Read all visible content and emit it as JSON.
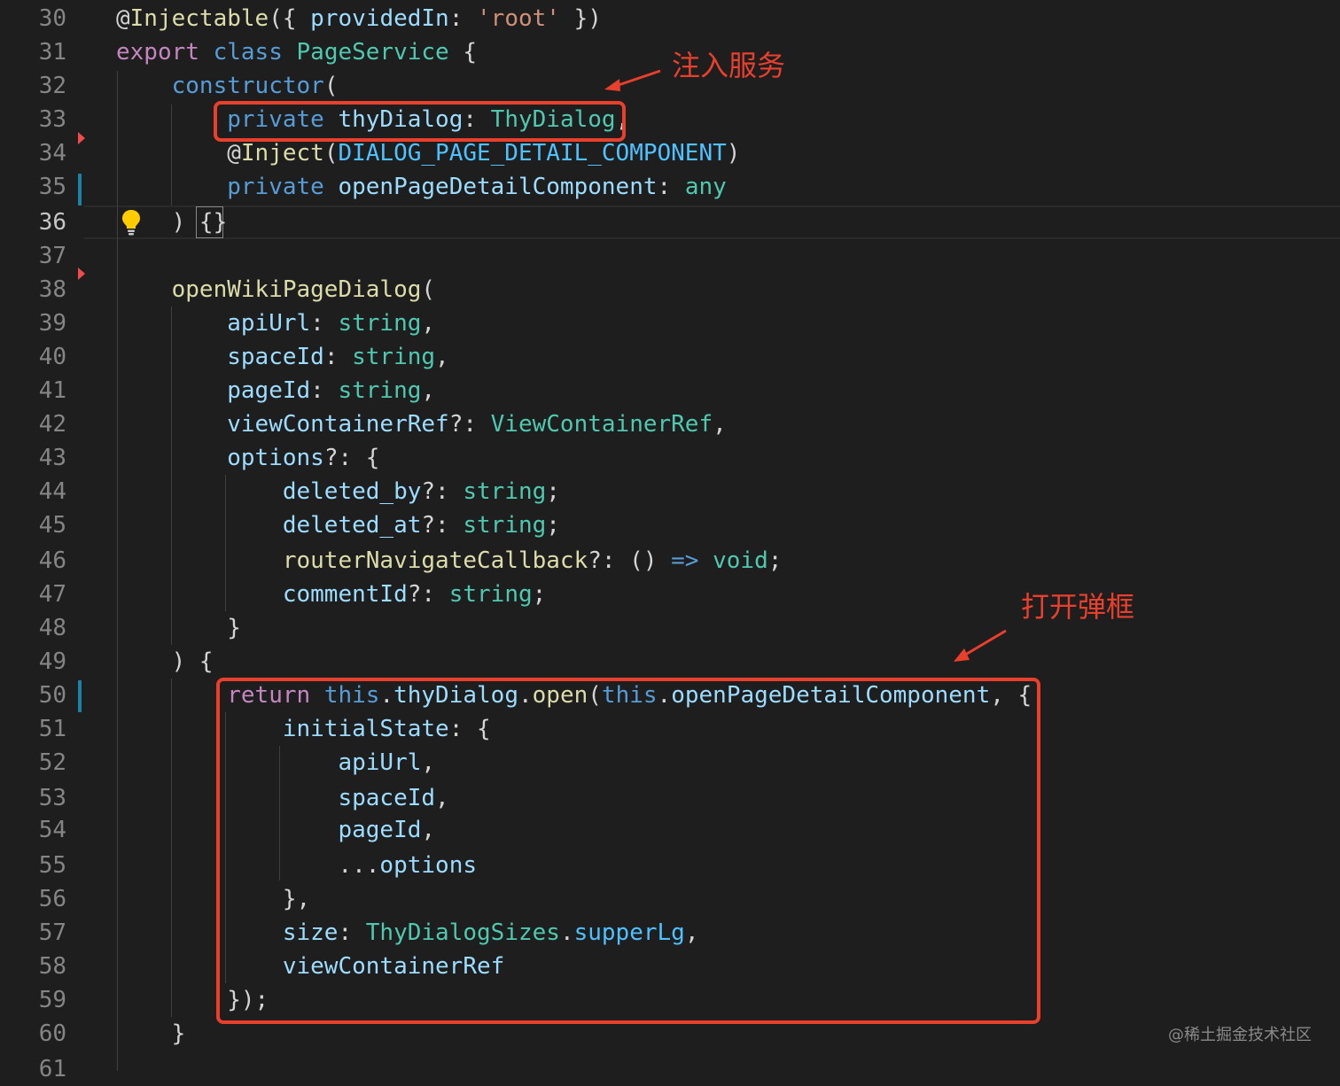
{
  "editor": {
    "line_numbers": [
      "30",
      "31",
      "32",
      "33",
      "34",
      "35",
      "36",
      "37",
      "38",
      "39",
      "40",
      "41",
      "42",
      "43",
      "44",
      "45",
      "46",
      "47",
      "48",
      "49",
      "50",
      "51",
      "52",
      "53",
      "54",
      "55",
      "56",
      "57",
      "58",
      "59",
      "60",
      "61"
    ],
    "active_line": "36",
    "lines": [
      [
        [
          "pun",
          "@"
        ],
        [
          "fn",
          "Injectable"
        ],
        [
          "pun",
          "({ "
        ],
        [
          "var",
          "providedIn"
        ],
        [
          "pun",
          ": "
        ],
        [
          "str",
          "'root'"
        ],
        [
          "pun",
          " })"
        ]
      ],
      [
        [
          "ctl",
          "export"
        ],
        [
          "pun",
          " "
        ],
        [
          "kw",
          "class"
        ],
        [
          "pun",
          " "
        ],
        [
          "ty",
          "PageService"
        ],
        [
          "pun",
          " {"
        ]
      ],
      [
        [
          "pun",
          "    "
        ],
        [
          "kw",
          "constructor"
        ],
        [
          "pun",
          "("
        ]
      ],
      [
        [
          "pun",
          "        "
        ],
        [
          "kw",
          "private"
        ],
        [
          "pun",
          " "
        ],
        [
          "var",
          "thyDialog"
        ],
        [
          "pun",
          ": "
        ],
        [
          "ty",
          "ThyDialog"
        ],
        [
          "pun",
          ","
        ]
      ],
      [
        [
          "pun",
          "        @"
        ],
        [
          "fn",
          "Inject"
        ],
        [
          "pun",
          "("
        ],
        [
          "const",
          "DIALOG_PAGE_DETAIL_COMPONENT"
        ],
        [
          "pun",
          ")"
        ]
      ],
      [
        [
          "pun",
          "        "
        ],
        [
          "kw",
          "private"
        ],
        [
          "pun",
          " "
        ],
        [
          "var",
          "openPageDetailComponent"
        ],
        [
          "pun",
          ": "
        ],
        [
          "ty",
          "any"
        ]
      ],
      [
        [
          "pun",
          "    ) {}"
        ]
      ],
      [],
      [
        [
          "pun",
          "    "
        ],
        [
          "fn",
          "openWikiPageDialog"
        ],
        [
          "pun",
          "("
        ]
      ],
      [
        [
          "pun",
          "        "
        ],
        [
          "var",
          "apiUrl"
        ],
        [
          "pun",
          ": "
        ],
        [
          "ty",
          "string"
        ],
        [
          "pun",
          ","
        ]
      ],
      [
        [
          "pun",
          "        "
        ],
        [
          "var",
          "spaceId"
        ],
        [
          "pun",
          ": "
        ],
        [
          "ty",
          "string"
        ],
        [
          "pun",
          ","
        ]
      ],
      [
        [
          "pun",
          "        "
        ],
        [
          "var",
          "pageId"
        ],
        [
          "pun",
          ": "
        ],
        [
          "ty",
          "string"
        ],
        [
          "pun",
          ","
        ]
      ],
      [
        [
          "pun",
          "        "
        ],
        [
          "var",
          "viewContainerRef"
        ],
        [
          "pun",
          "?: "
        ],
        [
          "ty",
          "ViewContainerRef"
        ],
        [
          "pun",
          ","
        ]
      ],
      [
        [
          "pun",
          "        "
        ],
        [
          "var",
          "options"
        ],
        [
          "pun",
          "?: {"
        ]
      ],
      [
        [
          "pun",
          "            "
        ],
        [
          "var",
          "deleted_by"
        ],
        [
          "pun",
          "?: "
        ],
        [
          "ty",
          "string"
        ],
        [
          "pun",
          ";"
        ]
      ],
      [
        [
          "pun",
          "            "
        ],
        [
          "var",
          "deleted_at"
        ],
        [
          "pun",
          "?: "
        ],
        [
          "ty",
          "string"
        ],
        [
          "pun",
          ";"
        ]
      ],
      [
        [
          "pun",
          "            "
        ],
        [
          "fn",
          "routerNavigateCallback"
        ],
        [
          "pun",
          "?: () "
        ],
        [
          "kw",
          "=>"
        ],
        [
          "pun",
          " "
        ],
        [
          "ty",
          "void"
        ],
        [
          "pun",
          ";"
        ]
      ],
      [
        [
          "pun",
          "            "
        ],
        [
          "var",
          "commentId"
        ],
        [
          "pun",
          "?: "
        ],
        [
          "ty",
          "string"
        ],
        [
          "pun",
          ";"
        ]
      ],
      [
        [
          "pun",
          "        }"
        ]
      ],
      [
        [
          "pun",
          "    ) {"
        ]
      ],
      [
        [
          "pun",
          "        "
        ],
        [
          "ctl",
          "return"
        ],
        [
          "pun",
          " "
        ],
        [
          "kw",
          "this"
        ],
        [
          "pun",
          "."
        ],
        [
          "var",
          "thyDialog"
        ],
        [
          "pun",
          "."
        ],
        [
          "fn",
          "open"
        ],
        [
          "pun",
          "("
        ],
        [
          "kw",
          "this"
        ],
        [
          "pun",
          "."
        ],
        [
          "var",
          "openPageDetailComponent"
        ],
        [
          "pun",
          ", {"
        ]
      ],
      [
        [
          "pun",
          "            "
        ],
        [
          "var",
          "initialState"
        ],
        [
          "pun",
          ": {"
        ]
      ],
      [
        [
          "pun",
          "                "
        ],
        [
          "var",
          "apiUrl"
        ],
        [
          "pun",
          ","
        ]
      ],
      [
        [
          "pun",
          "                "
        ],
        [
          "var",
          "spaceId"
        ],
        [
          "pun",
          ","
        ]
      ],
      [
        [
          "pun",
          "                "
        ],
        [
          "var",
          "pageId"
        ],
        [
          "pun",
          ","
        ]
      ],
      [
        [
          "pun",
          "                ..."
        ],
        [
          "var",
          "options"
        ]
      ],
      [
        [
          "pun",
          "            },"
        ]
      ],
      [
        [
          "pun",
          "            "
        ],
        [
          "var",
          "size"
        ],
        [
          "pun",
          ": "
        ],
        [
          "ty",
          "ThyDialogSizes"
        ],
        [
          "pun",
          "."
        ],
        [
          "const",
          "supperLg"
        ],
        [
          "pun",
          ","
        ]
      ],
      [
        [
          "pun",
          "            "
        ],
        [
          "var",
          "viewContainerRef"
        ]
      ],
      [
        [
          "pun",
          "        });"
        ]
      ],
      [
        [
          "pun",
          "    }"
        ]
      ],
      []
    ]
  },
  "annotations": {
    "inject_service": "注入服务",
    "open_dialog": "打开弹框"
  },
  "watermark": "@稀土掘金技术社区",
  "colors": {
    "background": "#1e1e1e",
    "annotation_red": "#e8402d",
    "git_modified": "#1b81a8",
    "git_deleted": "#f14c4c",
    "lightbulb": "#ffcc00"
  },
  "icons": {
    "lightbulb": "lightbulb-icon",
    "deleted_marker": "git-deleted-marker-icon"
  }
}
